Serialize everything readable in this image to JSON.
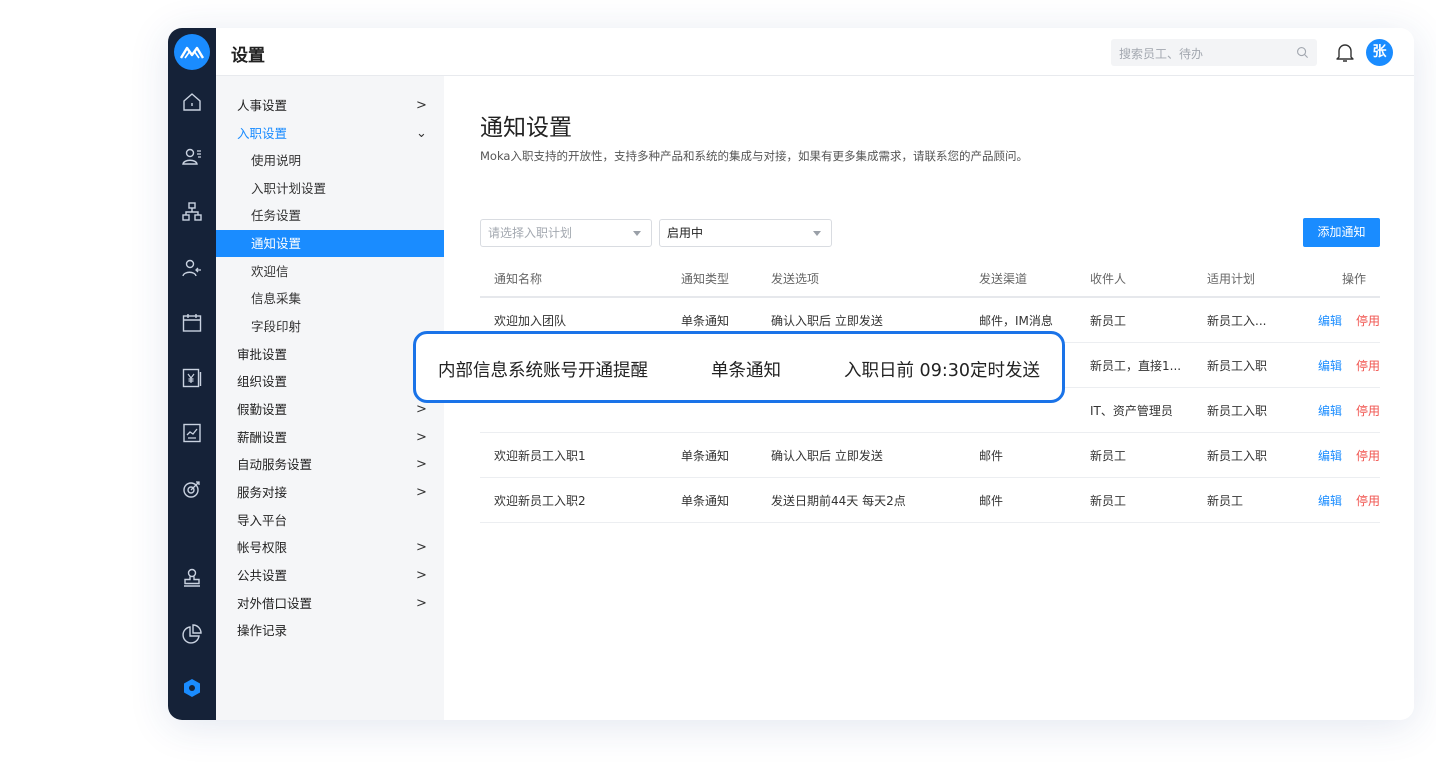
{
  "header": {
    "title": "设置",
    "search_placeholder": "搜索员工、待办",
    "avatar_text": "张"
  },
  "colors": {
    "accent": "#1a8cff",
    "rail": "#152238",
    "danger": "#f0534e"
  },
  "rail_icons": [
    "home-icon",
    "employees-icon",
    "org-chart-icon",
    "onboarding-icon",
    "calendar-icon",
    "salary-icon",
    "report-icon",
    "target-icon",
    "stamp-icon",
    "pie-chart-icon",
    "settings-hexagon-icon"
  ],
  "menu": {
    "items": [
      {
        "label": "人事设置",
        "arrow": ">"
      },
      {
        "label": "入职设置",
        "arrow": "⌄"
      },
      {
        "label": "使用说明",
        "arrow": ""
      },
      {
        "label": "入职计划设置",
        "arrow": ""
      },
      {
        "label": "任务设置",
        "arrow": ""
      },
      {
        "label": "通知设置",
        "arrow": ""
      },
      {
        "label": "欢迎信",
        "arrow": ""
      },
      {
        "label": "信息采集",
        "arrow": ""
      },
      {
        "label": "字段印射",
        "arrow": ""
      },
      {
        "label": "审批设置",
        "arrow": ""
      },
      {
        "label": "组织设置",
        "arrow": ""
      },
      {
        "label": "假勤设置",
        "arrow": ">"
      },
      {
        "label": "薪酬设置",
        "arrow": ">"
      },
      {
        "label": "自动服务设置",
        "arrow": ">"
      },
      {
        "label": "服务对接",
        "arrow": ">"
      },
      {
        "label": "导入平台",
        "arrow": ""
      },
      {
        "label": "帐号权限",
        "arrow": ">"
      },
      {
        "label": "公共设置",
        "arrow": ">"
      },
      {
        "label": "对外借口设置",
        "arrow": ">"
      },
      {
        "label": "操作记录",
        "arrow": ""
      }
    ]
  },
  "page": {
    "title": "通知设置",
    "description": "Moka入职支持的开放性，支持多种产品和系统的集成与对接，如果有更多集成需求，请联系您的产品顾问。",
    "plan_select_placeholder": "请选择入职计划",
    "status_select_value": "启用中",
    "add_button": "添加通知"
  },
  "table": {
    "headers": [
      "通知名称",
      "通知类型",
      "发送选项",
      "发送渠道",
      "收件人",
      "适用计划",
      "操作"
    ],
    "rows": [
      [
        "欢迎加入团队",
        "单条通知",
        "确认入职后 立即发送",
        "邮件，IM消息",
        "新员工",
        "新员工入..."
      ],
      [
        "",
        "",
        "",
        "",
        "新员工，直接1...",
        "新员工入职"
      ],
      [
        "",
        "",
        "",
        "",
        "IT、资产管理员",
        "新员工入职"
      ],
      [
        "欢迎新员工入职1",
        "单条通知",
        "确认入职后 立即发送",
        "邮件",
        "新员工",
        "新员工入职"
      ],
      [
        "欢迎新员工入职2",
        "单条通知",
        "发送日期前44天 每天2点",
        "邮件",
        "新员工",
        "新员工"
      ]
    ],
    "edit_label": "编辑",
    "disable_label": "停用"
  },
  "callout": {
    "name": "内部信息系统账号开通提醒",
    "type": "单条通知",
    "option": "入职日前 09:30定时发送"
  }
}
